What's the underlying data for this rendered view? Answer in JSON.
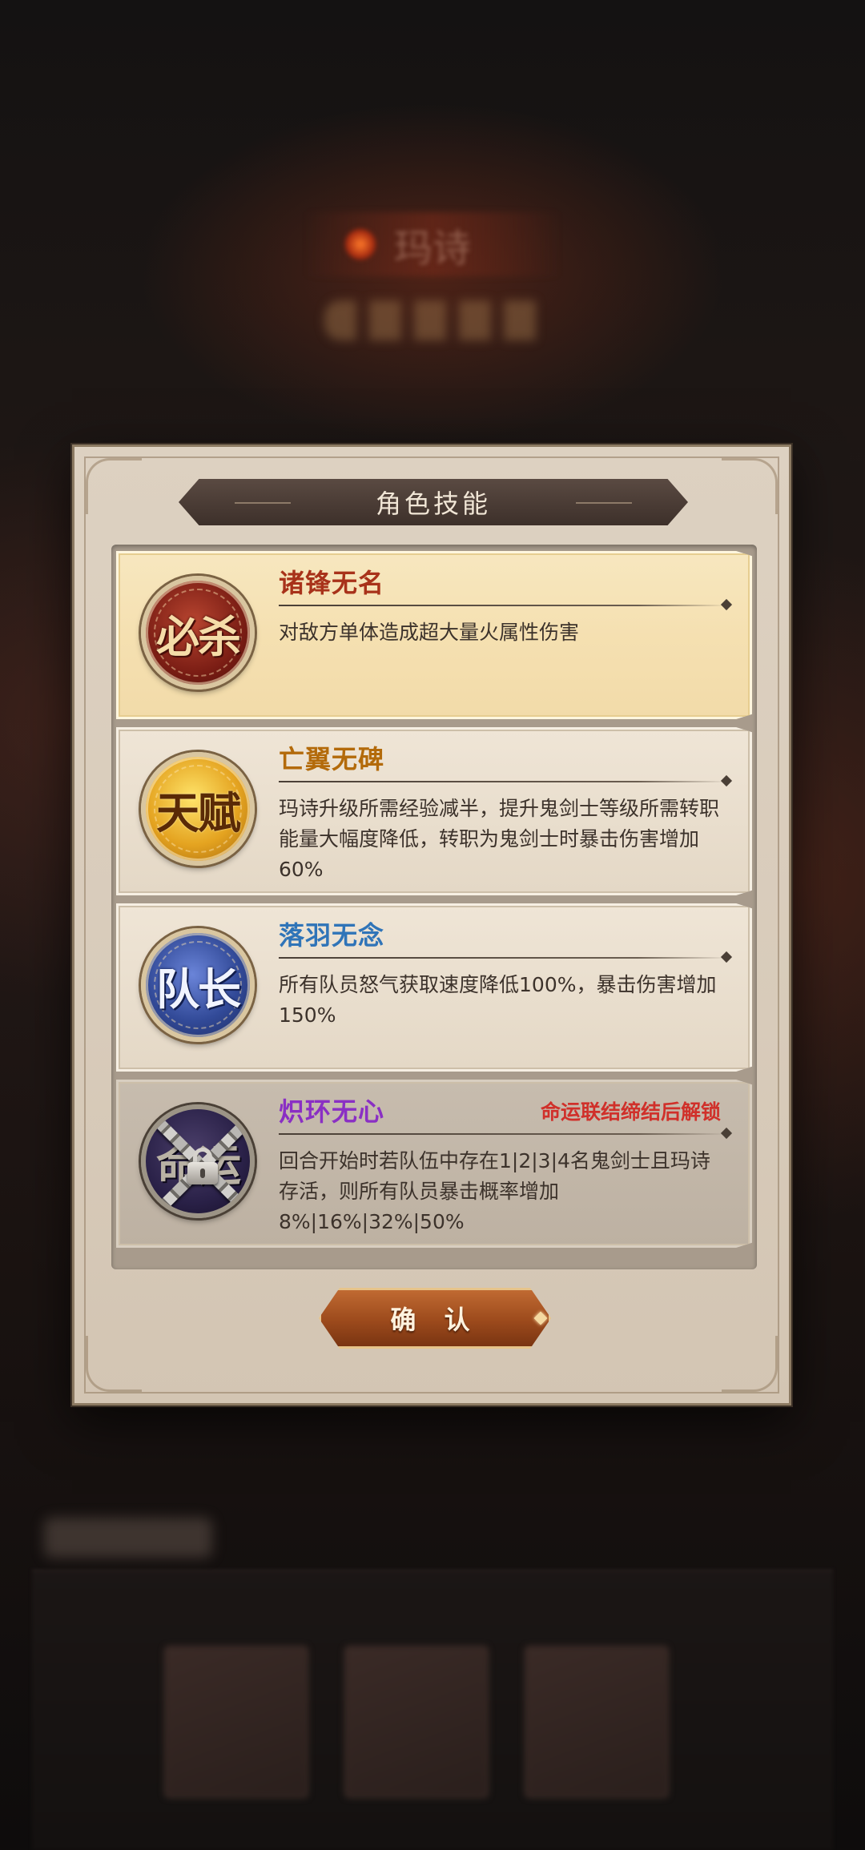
{
  "background": {
    "character_name": "玛诗"
  },
  "dialog": {
    "title": "角色技能",
    "confirm_label": "确 认"
  },
  "skills": [
    {
      "badge": "必杀",
      "badge_icon": "ultimate-medal-icon",
      "name": "诸锋无名",
      "name_color": "#a8321a",
      "description": "对敌方单体造成超大量火属性伤害",
      "state": "selected"
    },
    {
      "badge": "天赋",
      "badge_icon": "talent-medal-icon",
      "name": "亡翼无碑",
      "name_color": "#b36a0a",
      "description": "玛诗升级所需经验减半，提升鬼剑士等级所需转职能量大幅度降低，转职为鬼剑士时暴击伤害增加60%",
      "state": "normal"
    },
    {
      "badge": "队长",
      "badge_icon": "captain-medal-icon",
      "name": "落羽无念",
      "name_color": "#2f74b8",
      "description": "所有队员怒气获取速度降低100%，暴击伤害增加150%",
      "state": "normal"
    },
    {
      "badge": "命运",
      "badge_icon": "fate-medal-locked-icon",
      "name": "炽环无心",
      "name_color": "#8a2fc4",
      "description": "回合开始时若队伍中存在1|2|3|4名鬼剑士且玛诗存活，则所有队员暴击概率增加8%|16%|32%|50%",
      "state": "locked",
      "unlock_note": "命运联结缔结后解锁",
      "unlock_note_color": "#d0302a"
    }
  ]
}
